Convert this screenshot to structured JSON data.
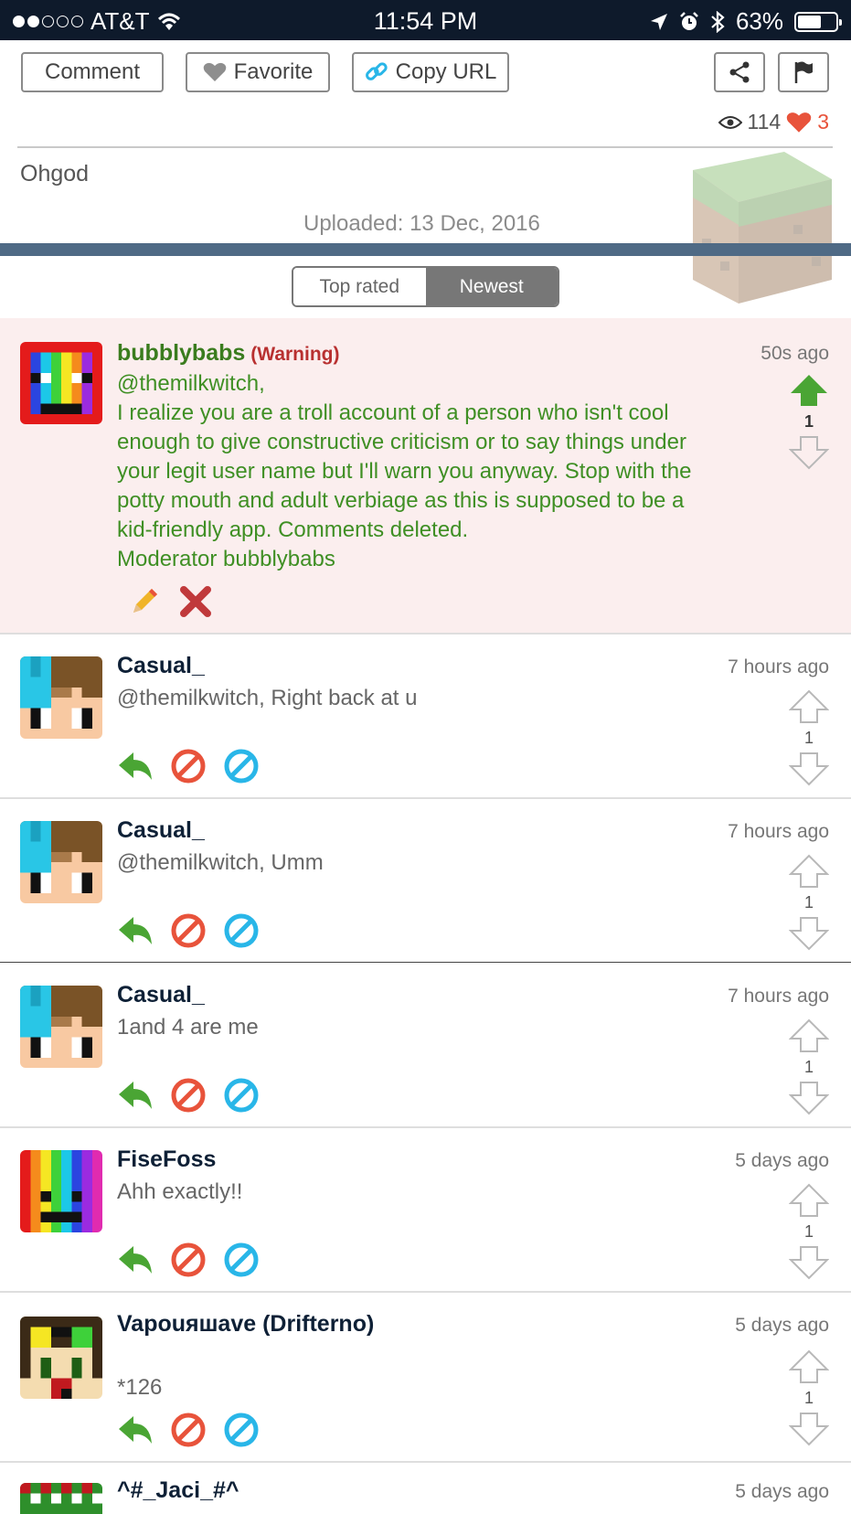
{
  "status": {
    "carrier": "AT&T",
    "time": "11:54 PM",
    "battery": "63%",
    "battery_level": 0.63
  },
  "toolbar": {
    "comment": "Comment",
    "favorite": "Favorite",
    "copy_url": "Copy URL"
  },
  "stats": {
    "views": "114",
    "likes": "3"
  },
  "post": {
    "title": "Ohgod",
    "uploaded": "Uploaded: 13 Dec, 2016"
  },
  "sort": {
    "top_rated": "Top rated",
    "newest": "Newest",
    "active": "Newest"
  },
  "comments": [
    {
      "user": "bubblybabs",
      "warning": "(Warning)",
      "time": "50s ago",
      "votes": "1",
      "lines": [
        "@themilkwitch,",
        "I realize you are a troll account of a person who isn't cool",
        "enough to give constructive criticism or to say things under",
        "your legit user name but I'll warn you anyway. Stop with the",
        "potty mouth and adult verbiage as this is supposed to be a",
        "kid-friendly app. Comments deleted.",
        "Moderator bubblybabs"
      ]
    },
    {
      "user": "Casual_",
      "time": "7 hours ago",
      "text": "@themilkwitch, Right back at u",
      "votes": "1"
    },
    {
      "user": "Casual_",
      "time": "7 hours ago",
      "text": "@themilkwitch, Umm",
      "votes": "1"
    },
    {
      "user": "Casual_",
      "time": "7 hours ago",
      "text": "1and 4 are me",
      "votes": "1"
    },
    {
      "user": "FiseFoss",
      "time": "5 days ago",
      "text": "Ahh exactly!!",
      "votes": "1"
    },
    {
      "user": "Vapouяшave (Drifterno)",
      "time": "5 days ago",
      "text": "*126",
      "votes": "1"
    },
    {
      "user": "^#_Jaci_#^",
      "time": "5 days ago"
    }
  ],
  "colors": {
    "accent_green": "#3f8f24",
    "warning_red": "#b83030",
    "status_bar": "#0e1a2b",
    "divider_blue": "#4f6a85",
    "mod_bg": "#fbeeee",
    "reply_green": "#4aa534",
    "block_red": "#e8533b",
    "ignore_blue": "#29b6e8"
  }
}
